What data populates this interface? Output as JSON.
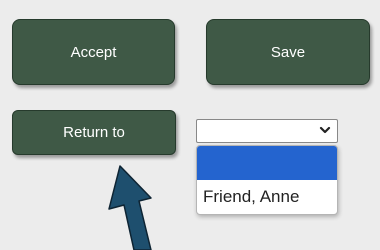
{
  "buttons": {
    "accept_label": "Accept",
    "save_label": "Save",
    "return_label": "Return to"
  },
  "select": {
    "value": "",
    "options": [
      "",
      "Friend, Anne"
    ]
  },
  "annotation": {
    "arrow_color": "#1e4f6e",
    "arrow_icon": "pointer-arrow-icon"
  },
  "colors": {
    "button_bg": "#3f5946",
    "selection_highlight": "#2464cf",
    "page_bg": "#ececec"
  }
}
